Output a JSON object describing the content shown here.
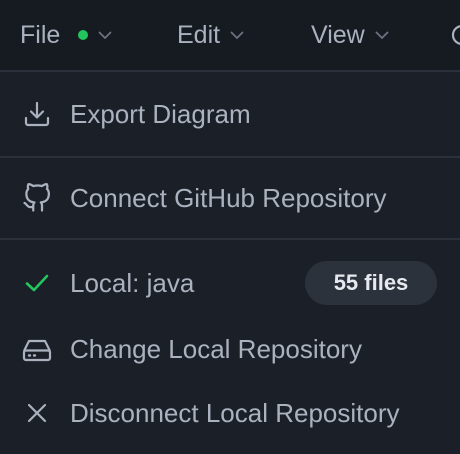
{
  "menubar": {
    "menus": [
      {
        "label": "File",
        "status_color": "#22c55e"
      },
      {
        "label": "Edit"
      },
      {
        "label": "View"
      }
    ]
  },
  "dropdown": {
    "export_label": "Export Diagram",
    "connect_github_label": "Connect GitHub Repository",
    "local_status_label": "Local: java",
    "local_file_count": "55 files",
    "change_local_label": "Change Local Repository",
    "disconnect_local_label": "Disconnect Local Repository"
  },
  "icons": {
    "export": "download-icon",
    "github": "github-icon",
    "local_status": "check-icon",
    "change_local": "hard-drive-icon",
    "disconnect": "close-icon"
  },
  "colors": {
    "background": "#1b1f27",
    "menubar_background": "#161a21",
    "text": "#aab2bf",
    "separator": "#2b313b",
    "success": "#22c55e",
    "badge_background": "#2c323c"
  }
}
